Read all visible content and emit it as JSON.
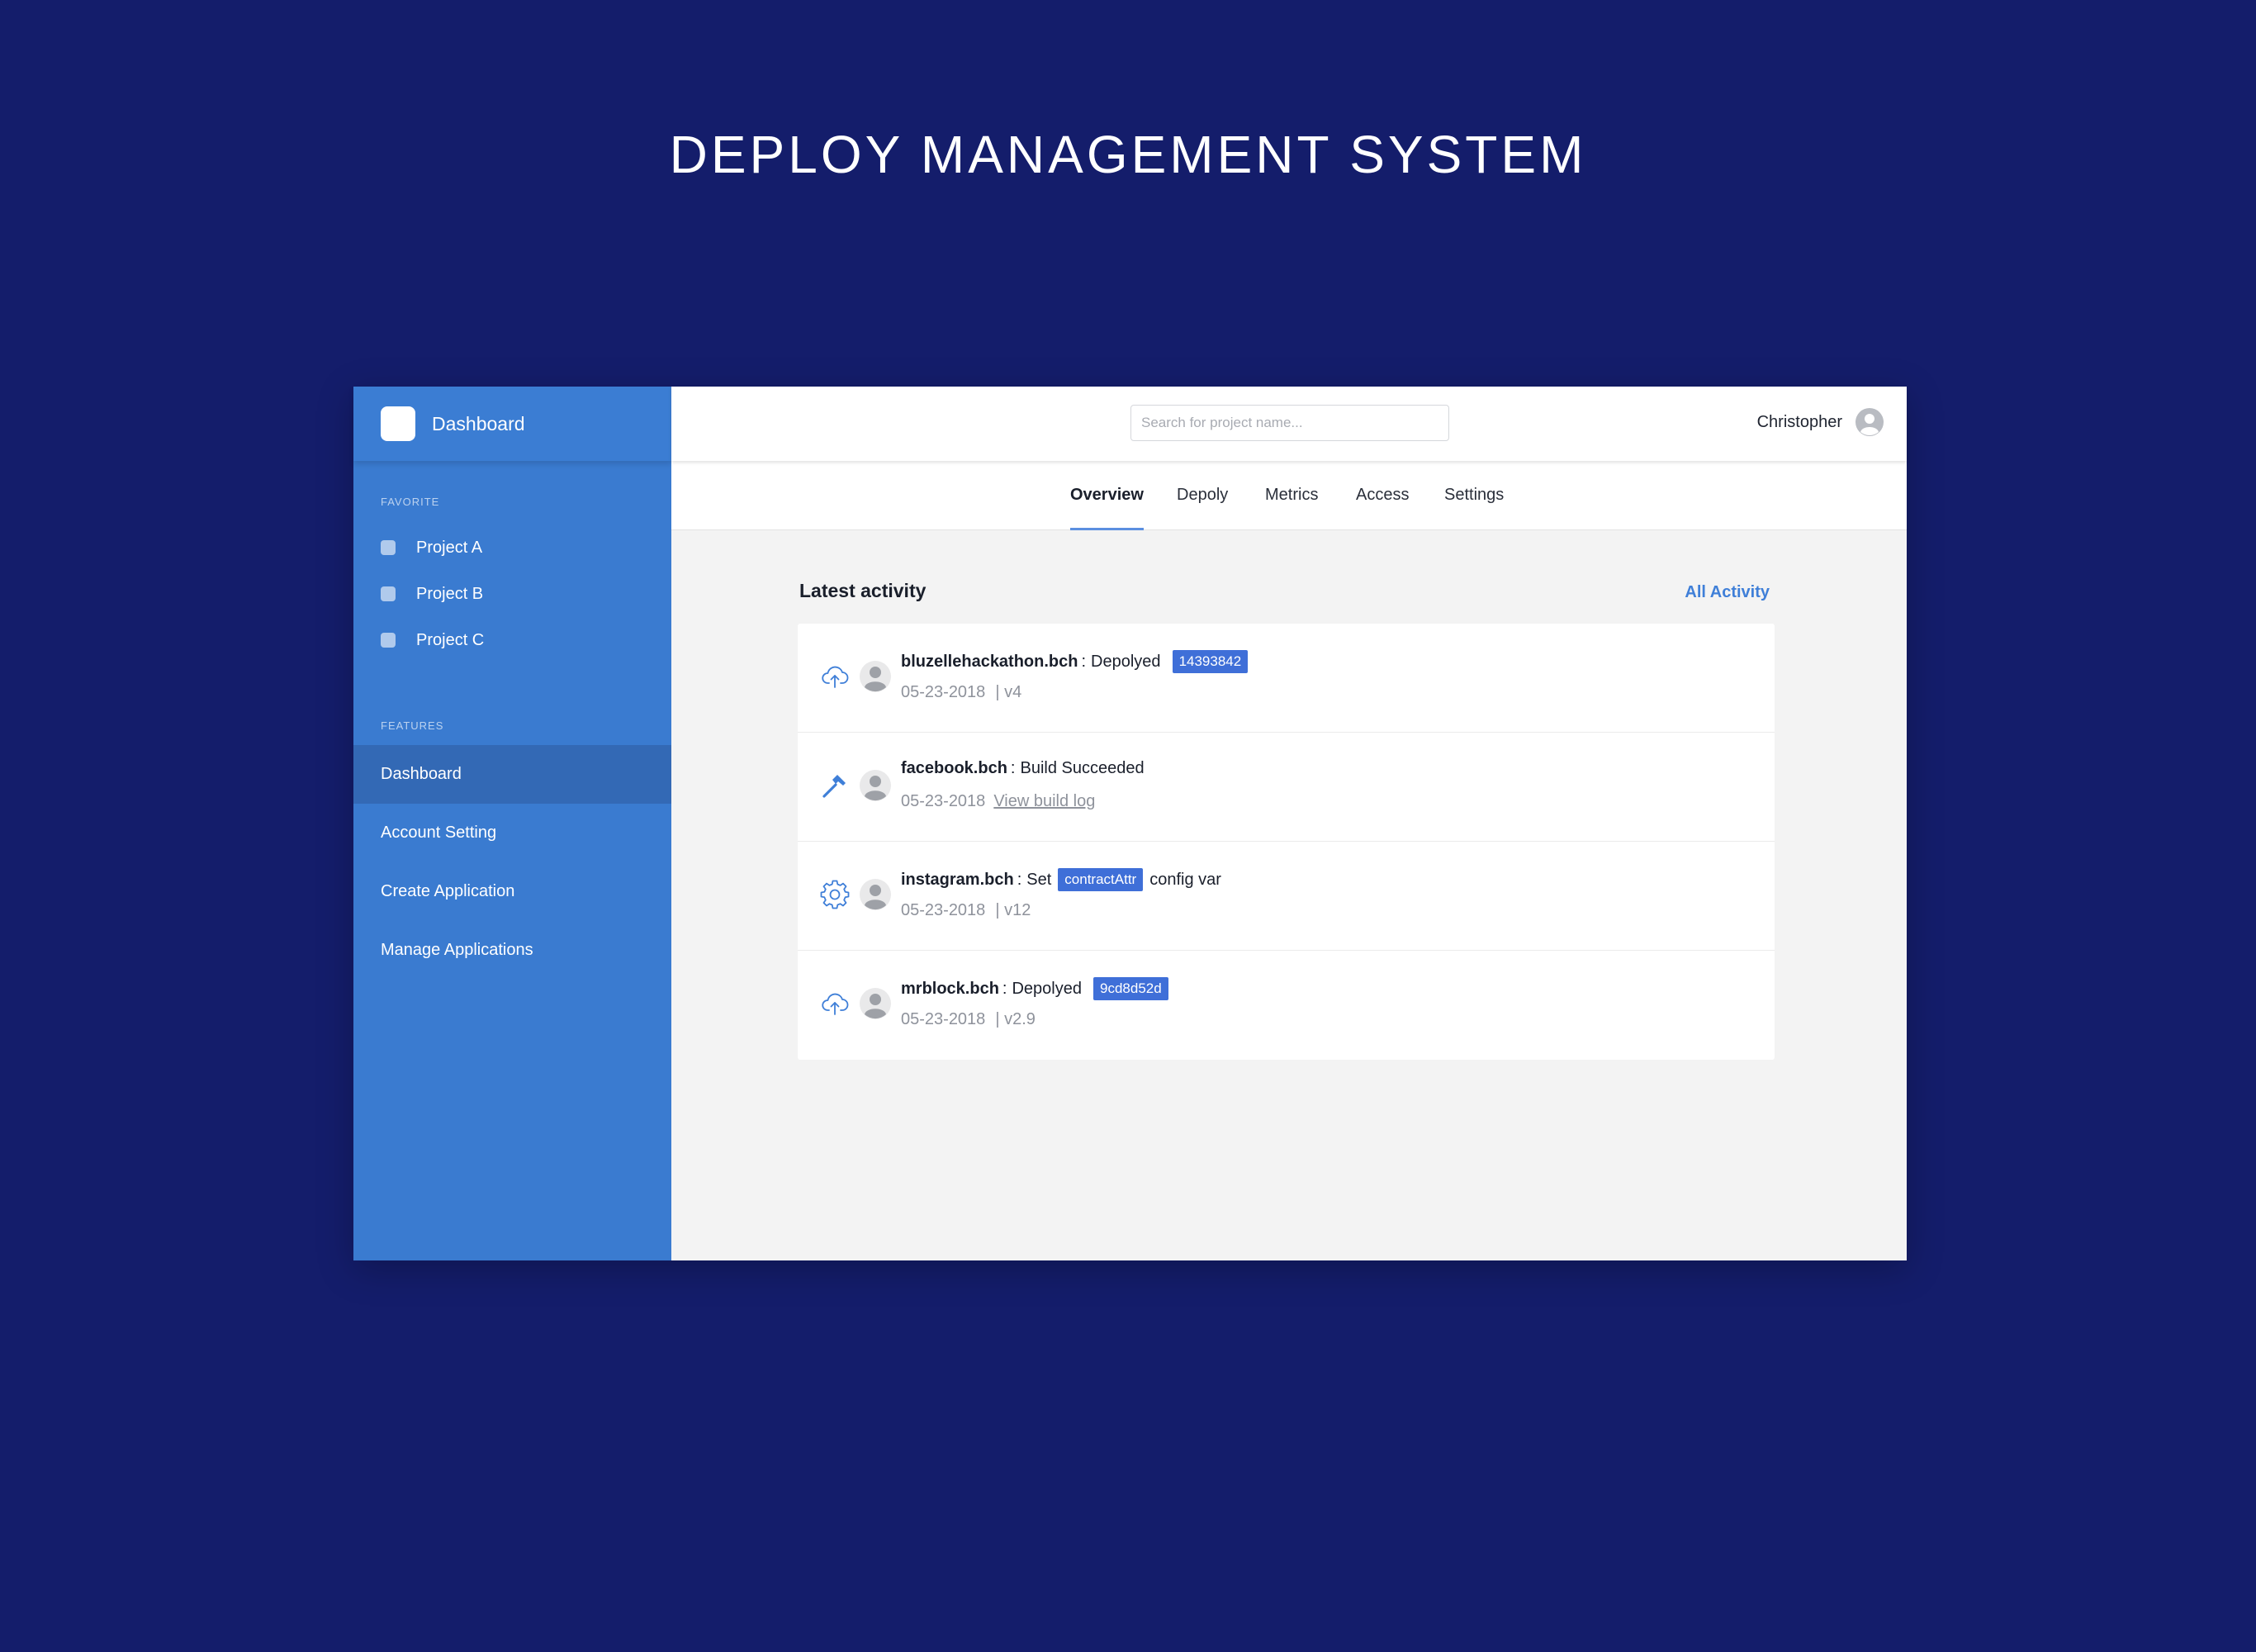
{
  "page_title": "DEPLOY MANAGEMENT SYSTEM",
  "colors": {
    "background": "#141d6b",
    "sidebar": "#3a7bd0",
    "sidebar_active": "#3369b5",
    "accent": "#3f6fd8",
    "link": "#3f7fd8"
  },
  "sidebar": {
    "brand_label": "Dashboard",
    "favorite_label": "FAVORITE",
    "favorites": [
      {
        "label": "Project A"
      },
      {
        "label": "Project B"
      },
      {
        "label": "Project C"
      }
    ],
    "features_label": "FEATURES",
    "nav": [
      {
        "label": "Dashboard",
        "active": true
      },
      {
        "label": "Account Setting",
        "active": false
      },
      {
        "label": "Create Application",
        "active": false
      },
      {
        "label": "Manage Applications",
        "active": false
      }
    ]
  },
  "topbar": {
    "search_placeholder": "Search for project name...",
    "user_name": "Christopher",
    "avatar_icon": "user-avatar-icon"
  },
  "tabs": [
    {
      "label": "Overview",
      "active": true
    },
    {
      "label": "Depoly",
      "active": false
    },
    {
      "label": "Metrics",
      "active": false
    },
    {
      "label": "Access",
      "active": false
    },
    {
      "label": "Settings",
      "active": false
    }
  ],
  "activity": {
    "title": "Latest activity",
    "all_link": "All Activity",
    "items": [
      {
        "icon": "cloud-upload-icon",
        "project": "bluzellehackathon.bch",
        "sep": ":",
        "action": "Depolyed",
        "badge": "14393842",
        "date": "05-23-2018",
        "meta": "| v4"
      },
      {
        "icon": "hammer-icon",
        "project": "facebook.bch",
        "sep": ":",
        "action": "Build Succeeded",
        "date": "05-23-2018",
        "link": "View build log"
      },
      {
        "icon": "gear-icon",
        "project": "instagram.bch",
        "sep": ":",
        "action": "Set",
        "badge": "contractAttr",
        "suffix": "config var",
        "date": "05-23-2018",
        "meta": "| v12"
      },
      {
        "icon": "cloud-upload-icon",
        "project": "mrblock.bch",
        "sep": ":",
        "action": "Depolyed",
        "badge": "9cd8d52d",
        "date": "05-23-2018",
        "meta": "| v2.9"
      }
    ]
  }
}
